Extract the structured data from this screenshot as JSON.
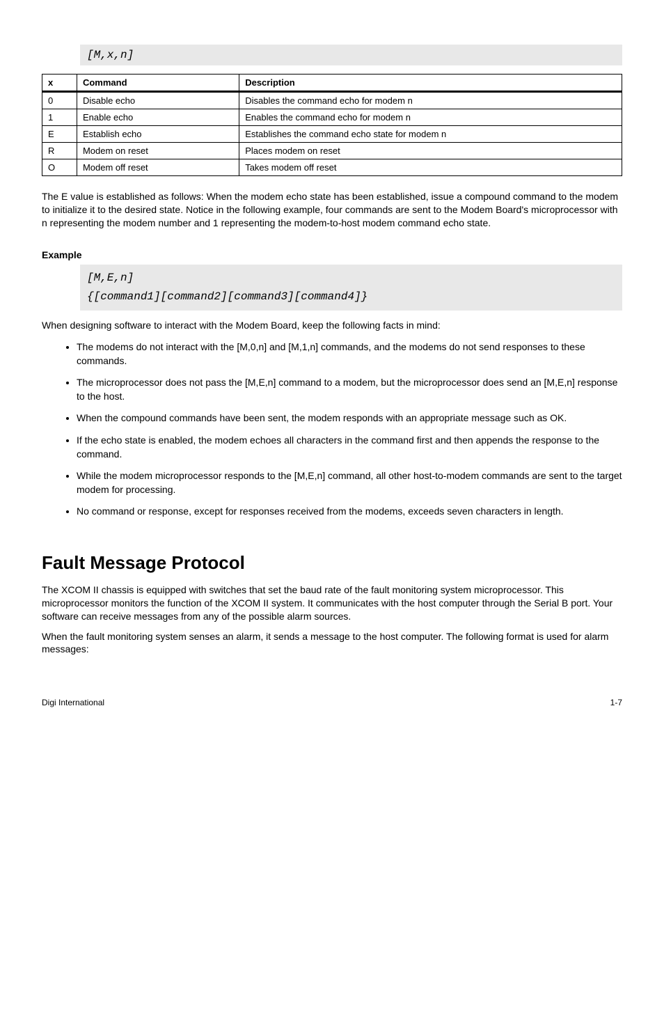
{
  "codeBlock1": "[M,x,n]",
  "table": {
    "headers": [
      "x",
      "Command",
      "Description"
    ],
    "rows": [
      [
        "0",
        "Disable echo",
        "Disables the command echo for modem n"
      ],
      [
        "1",
        "Enable echo",
        "Enables the command echo for modem n"
      ],
      [
        "E",
        "Establish echo",
        "Establishes the command echo state for modem n"
      ],
      [
        "R",
        "Modem on reset",
        "Places modem on reset"
      ],
      [
        "O",
        "Modem off reset",
        "Takes modem off reset"
      ]
    ]
  },
  "para1": "The E value is established as follows: When the modem echo state has been established, issue a compound command to the modem to initialize it to the desired state. Notice in the following example, four commands are sent to the Modem Board's microprocessor with n representing the modem number and 1 representing the modem-to-host modem command echo state.",
  "subhead1": "Example",
  "codeBlock2": "[M,E,n]\n{[command1][command2][command3][command4]}",
  "para2": "When designing software to interact with the Modem Board, keep the following facts in mind:",
  "rules": [
    "The modems do not interact with the [M,0,n] and [M,1,n] commands, and the modems do not send responses to these commands.",
    "The microprocessor does not pass the [M,E,n] command to a modem, but the microprocessor does send an [M,E,n] response to the host.",
    "When the compound commands have been sent, the modem responds with an appropriate message such as OK.",
    "If the echo state is enabled, the modem echoes all characters in the command first and then appends the response to the command.",
    "While the modem microprocessor responds to the [M,E,n] command, all other host-to-modem commands are sent to the target modem for processing.",
    "No command or response, except for responses received from the modems, exceeds seven characters in length."
  ],
  "heading": "Fault Message Protocol",
  "para3": "The XCOM II chassis is equipped with switches that set the baud rate of the fault monitoring system microprocessor. This microprocessor monitors the function of the XCOM II system. It communicates with the host computer through the Serial B port. Your software can receive messages from any of the possible alarm sources.",
  "para4": "When the fault monitoring system senses an alarm, it sends a message to the host computer. The following format is used for alarm messages:",
  "footerLeft": "Digi International",
  "footerRight": "1-7"
}
